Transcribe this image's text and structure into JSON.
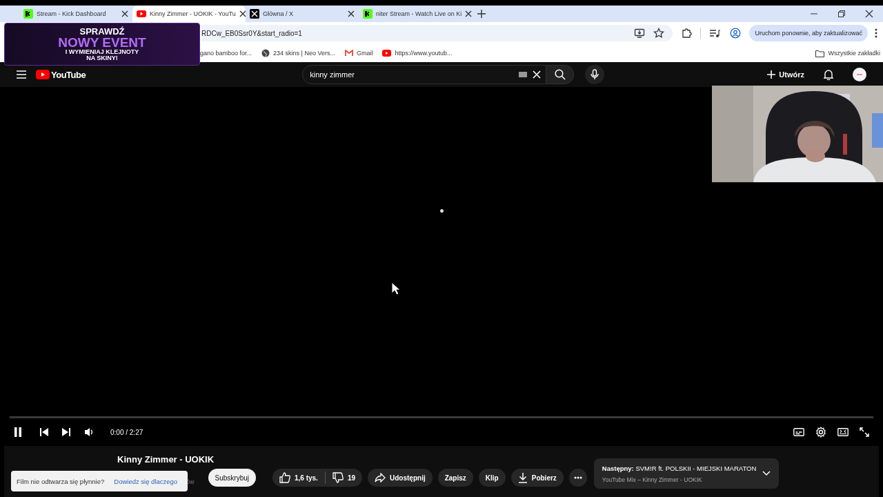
{
  "browser": {
    "tabs": [
      {
        "title": "Stream - Kick Dashboard",
        "kind": "kick",
        "selected": false
      },
      {
        "title": "Kinny Zimmer - UOKIK - YouTu",
        "kind": "youtube",
        "selected": true
      },
      {
        "title": "Główna / X",
        "kind": "x",
        "selected": false
      },
      {
        "title": "niter Stream - Watch Live on Ki",
        "kind": "kick",
        "selected": false
      }
    ],
    "url": "RDCw_EB0Ssr0Y&start_radio=1",
    "update_button": "Uruchom ponownie, aby zaktualizować",
    "bookmarks": [
      {
        "label": "gano bamboo for...",
        "kind": "plain"
      },
      {
        "label": "234 skins | Neo Vers...",
        "kind": "globe"
      },
      {
        "label": "Gmail",
        "kind": "gmail"
      },
      {
        "label": "https://www.youtub...",
        "kind": "youtube"
      }
    ],
    "all_bookmarks": "Wszystkie zakładki"
  },
  "promo": {
    "line_1": "SPRAWDŹ",
    "line_2": "NOWY EVENT",
    "line_3": "I WYMIENIAJ KLEJNOTY",
    "line_4": "NA SKINY!"
  },
  "youtube": {
    "logo": "YouTube",
    "search": {
      "value": "kinny zimmer"
    },
    "create_button": "Utwórz",
    "player": {
      "playing": true,
      "time": "0:00 / 2:27"
    },
    "video_title": "Kinny Zimmer - UOKIK",
    "subscribers_fragment": "ów",
    "toast": {
      "text": "Film nie odtwarza się płynnie?",
      "link": "Dowiedz się dlaczego"
    },
    "subscribe_button": "Subskrybuj",
    "likes": "1,6 tys.",
    "dislikes": "19",
    "actions": [
      {
        "label": "Udostępnij",
        "kind": "share"
      },
      {
        "label": "Zapisz",
        "kind": "plain"
      },
      {
        "label": "Klip",
        "kind": "plain"
      },
      {
        "label": "Pobierz",
        "kind": "download"
      }
    ],
    "up_next": {
      "label": "Następny:",
      "title": "SVM!R ft. POLSKII - MIEJSKI MARATON",
      "subtitle": "YouTube Mix – Kinny Zimmer - UOKIK"
    }
  }
}
